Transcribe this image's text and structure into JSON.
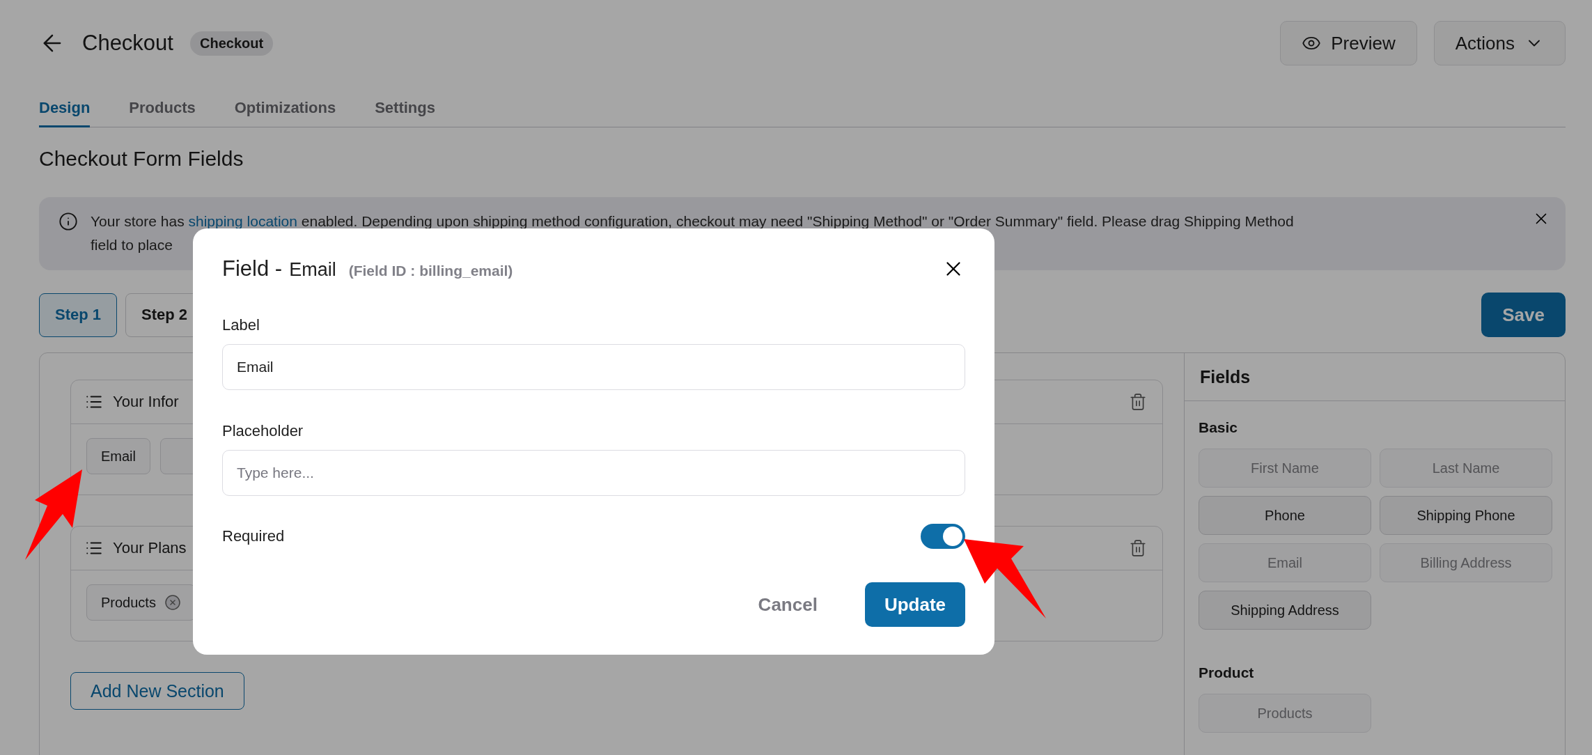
{
  "header": {
    "title": "Checkout",
    "badge": "Checkout",
    "buttons": [
      {
        "label": "Preview",
        "kind": "preview"
      },
      {
        "label": "Actions",
        "kind": "menu"
      }
    ]
  },
  "tabs": [
    {
      "label": "Design",
      "selected": true
    },
    {
      "label": "Products",
      "selected": false
    },
    {
      "label": "Optimizations",
      "selected": false
    },
    {
      "label": "Settings",
      "selected": false
    }
  ],
  "heading": "Checkout Form Fields",
  "notice": {
    "before_link": "Your store has ",
    "link": "shipping location",
    "after_link": " enabled. Depending upon shipping method configuration, checkout may need \"Shipping Method\" or \"Order Summary\" field. Please drag Shipping Method",
    "line_2": "field to place"
  },
  "steps": [
    {
      "label": "Step 1",
      "selected": true
    },
    {
      "label": "Step 2",
      "selected": false
    }
  ],
  "save_button": "Save",
  "sections": [
    {
      "title": "Your Infor",
      "chips": [
        {
          "label": "Email",
          "removable": false
        },
        {
          "removable": false
        }
      ]
    },
    {
      "title": "Your Plans",
      "chips": [
        {
          "label": "Products",
          "removable": true
        }
      ]
    }
  ],
  "add_section_button": "Add New Section",
  "fields_panel": {
    "title": "Fields",
    "groups": [
      {
        "title": "Basic",
        "items": [
          {
            "label": "First Name",
            "disabled": true
          },
          {
            "label": "Last Name",
            "disabled": true
          },
          {
            "label": "Phone",
            "disabled": false
          },
          {
            "label": "Shipping Phone",
            "disabled": false
          },
          {
            "label": "Email",
            "disabled": true
          },
          {
            "label": "Billing Address",
            "disabled": true
          },
          {
            "label": "Shipping Address",
            "disabled": false
          }
        ]
      },
      {
        "title": "Product",
        "items": [
          {
            "label": "Products",
            "disabled": true
          }
        ]
      }
    ]
  },
  "modal": {
    "title": "Field -",
    "field_name": "Email",
    "field_id": "(Field ID : billing_email)",
    "label_field": {
      "label": "Label",
      "value": "Email"
    },
    "placeholder_field": {
      "label": "Placeholder",
      "placeholder": "Type here..."
    },
    "required": {
      "label": "Required",
      "on": true
    },
    "buttons": [
      {
        "label": "Cancel",
        "kind": "secondary"
      },
      {
        "label": "Update",
        "kind": "primary"
      }
    ]
  }
}
